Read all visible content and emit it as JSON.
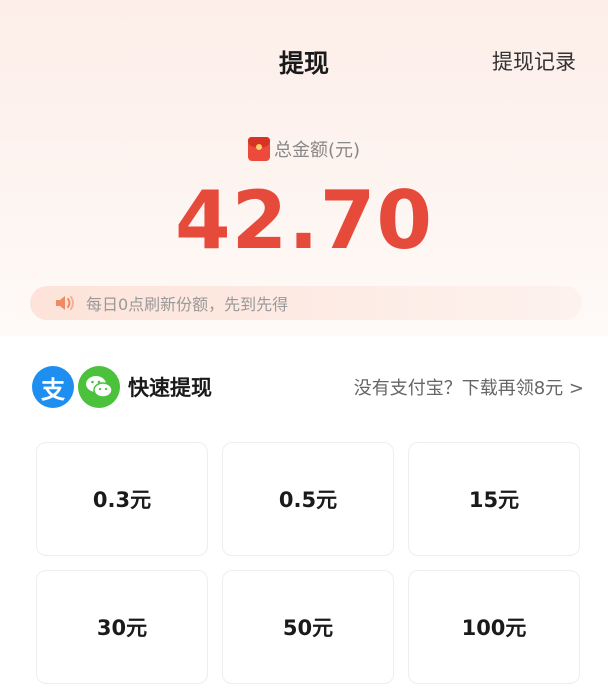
{
  "header": {
    "title": "提现",
    "history_link": "提现记录"
  },
  "balance": {
    "label": "总金额(元)",
    "amount": "42.70",
    "amount_color": "#e64a3b"
  },
  "notice": {
    "text": "每日0点刷新份额，先到先得",
    "icon": "speaker-icon"
  },
  "quick_withdraw": {
    "title": "快速提现",
    "alipay_glyph": "支",
    "download_link": "没有支付宝？下载再领8元 >",
    "alipay_color": "#1e8ff0",
    "wechat_color": "#4cc13c"
  },
  "amount_options": [
    {
      "label": "0.3元"
    },
    {
      "label": "0.5元"
    },
    {
      "label": "15元"
    },
    {
      "label": "30元"
    },
    {
      "label": "50元"
    },
    {
      "label": "100元"
    }
  ]
}
